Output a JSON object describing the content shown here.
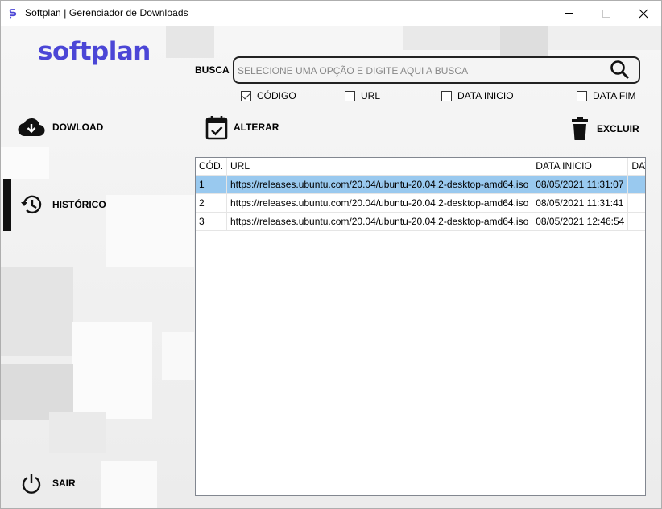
{
  "window": {
    "title": "Softplan | Gerenciador de Downloads",
    "close_glyph": "✕"
  },
  "brand": {
    "logo_text": "softplan",
    "accent_color": "#4b46d6"
  },
  "nav": {
    "download_label": "DOWLOAD",
    "history_label": "HISTÓRICO",
    "exit_label": "SAIR"
  },
  "search": {
    "label": "BUSCA",
    "placeholder": "SELECIONE UMA OPÇÃO E DIGITE AQUI A BUSCA",
    "value": ""
  },
  "filters": [
    {
      "label": "CÓDIGO",
      "checked": true
    },
    {
      "label": "URL",
      "checked": false
    },
    {
      "label": "DATA INICIO",
      "checked": false
    },
    {
      "label": "DATA FIM",
      "checked": false
    }
  ],
  "actions": {
    "alterar_label": "ALTERAR",
    "excluir_label": "EXCLUIR"
  },
  "table": {
    "columns": [
      "CÓD.",
      "URL",
      "DATA INICIO",
      "DATA FIM"
    ],
    "rows": [
      {
        "cod": "1",
        "url": "https://releases.ubuntu.com/20.04/ubuntu-20.04.2-desktop-amd64.iso",
        "data_inicio": "08/05/2021 11:31:07",
        "data_fim": "",
        "selected": true
      },
      {
        "cod": "2",
        "url": "https://releases.ubuntu.com/20.04/ubuntu-20.04.2-desktop-amd64.iso",
        "data_inicio": "08/05/2021 11:31:41",
        "data_fim": "",
        "selected": false
      },
      {
        "cod": "3",
        "url": "https://releases.ubuntu.com/20.04/ubuntu-20.04.2-desktop-amd64.iso",
        "data_inicio": "08/05/2021 12:46:54",
        "data_fim": "",
        "selected": false
      }
    ]
  },
  "icons": {
    "download": "cloud-download-icon",
    "history": "history-icon",
    "exit": "power-icon",
    "search": "search-icon",
    "alterar": "calendar-check-icon",
    "excluir": "trash-icon"
  }
}
